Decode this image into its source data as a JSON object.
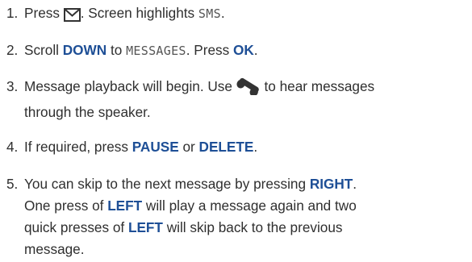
{
  "steps": [
    {
      "number": "1.",
      "parts": [
        {
          "type": "text",
          "value": "Press "
        },
        {
          "type": "icon",
          "icon": "envelope-icon"
        },
        {
          "type": "text",
          "value": ". Screen highlights "
        },
        {
          "type": "lcd",
          "value": "SMS"
        },
        {
          "type": "text",
          "value": "."
        }
      ]
    },
    {
      "number": "2.",
      "parts": [
        {
          "type": "text",
          "value": "Scroll "
        },
        {
          "type": "kw",
          "value": "DOWN"
        },
        {
          "type": "text",
          "value": " to "
        },
        {
          "type": "lcd",
          "value": "MESSAGES"
        },
        {
          "type": "text",
          "value": ". Press "
        },
        {
          "type": "kw",
          "value": "OK"
        },
        {
          "type": "text",
          "value": "."
        }
      ]
    },
    {
      "number": "3.",
      "parts": [
        {
          "type": "text",
          "value": "Message playback will begin. Use "
        },
        {
          "type": "icon",
          "icon": "handset-icon"
        },
        {
          "type": "text",
          "value": " to hear messages"
        },
        {
          "type": "br"
        },
        {
          "type": "text",
          "value": "through the speaker."
        }
      ]
    },
    {
      "number": "4.",
      "parts": [
        {
          "type": "text",
          "value": "If required, press "
        },
        {
          "type": "kw",
          "value": "PAUSE"
        },
        {
          "type": "text",
          "value": " or "
        },
        {
          "type": "kw",
          "value": "DELETE"
        },
        {
          "type": "text",
          "value": "."
        }
      ]
    },
    {
      "number": "5.",
      "parts": [
        {
          "type": "text",
          "value": "You can skip to the next message by pressing "
        },
        {
          "type": "kw",
          "value": "RIGHT"
        },
        {
          "type": "text",
          "value": "."
        },
        {
          "type": "br"
        },
        {
          "type": "text",
          "value": "One press of "
        },
        {
          "type": "kw",
          "value": "LEFT"
        },
        {
          "type": "text",
          "value": " will play a message again and two"
        },
        {
          "type": "br"
        },
        {
          "type": "text",
          "value": "quick presses of "
        },
        {
          "type": "kw",
          "value": "LEFT"
        },
        {
          "type": "text",
          "value": " will skip back to the previous"
        },
        {
          "type": "br"
        },
        {
          "type": "text",
          "value": "message."
        }
      ]
    }
  ],
  "colors": {
    "keyword": "#1e4f96",
    "body_text": "#2f2f2f",
    "icon": "#333333"
  }
}
